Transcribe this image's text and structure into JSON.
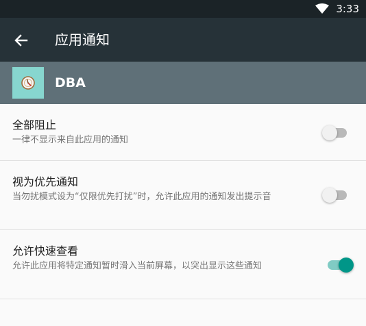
{
  "status_bar": {
    "time": "3:33",
    "wifi_icon": "wifi-icon"
  },
  "app_bar": {
    "back_icon": "arrow-left-icon",
    "title": "应用通知"
  },
  "app_header": {
    "icon": "dba-app-icon",
    "name": "DBA"
  },
  "settings": [
    {
      "title": "全部阻止",
      "summary": "一律不显示来自此应用的通知",
      "enabled": false
    },
    {
      "title": "视为优先通知",
      "summary": "当勿扰模式设为“仅限优先打扰”时，允许此应用的通知发出提示音",
      "enabled": false
    },
    {
      "title": "允许快速查看",
      "summary": "允许此应用将特定通知暂时滑入当前屏幕，以突出显示这些通知",
      "enabled": true
    }
  ],
  "colors": {
    "status_bar": "#1b2327",
    "app_bar": "#263238",
    "app_header": "#5f7078",
    "accent": "#009688"
  }
}
